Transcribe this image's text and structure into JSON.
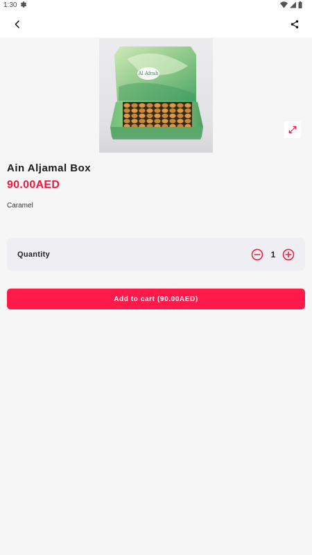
{
  "status_bar": {
    "time": "1:30",
    "icons": [
      "settings-icon",
      "wifi-icon",
      "signal-icon",
      "battery-icon"
    ]
  },
  "app_bar": {
    "back_icon": "back-arrow-icon",
    "share_icon": "share-icon"
  },
  "product": {
    "image_icon": "product-image",
    "image_text": "Al Afrah",
    "name": "Ain Aljamal Box",
    "price": "90.00AED",
    "description": "Caramel"
  },
  "quantity": {
    "label": "Quantity",
    "value": "1"
  },
  "cart": {
    "button_label": "Add to cart (90.00AED)"
  },
  "colors": {
    "accent": "#f0183f",
    "button": "#ff1a4a",
    "background": "#f6f6f7",
    "card": "#efeef3"
  }
}
